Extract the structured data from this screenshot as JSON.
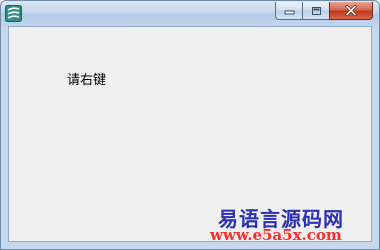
{
  "window": {
    "buttons": {
      "minimize": "minimize",
      "maximize": "maximize",
      "close": "close"
    }
  },
  "client": {
    "hint_text": "请右键"
  },
  "watermark": {
    "title": "易语言源码网",
    "url": "www.e5a5x.com"
  },
  "colors": {
    "titlebar": "#c3d7ed",
    "client_bg": "#f0f0f0",
    "close_button": "#c9452c",
    "watermark_title": "#2a2fb4",
    "watermark_url": "#ff2a2a"
  },
  "icons": {
    "app": "app-icon",
    "minimize": "minimize-icon",
    "maximize": "maximize-icon",
    "close": "close-icon"
  }
}
